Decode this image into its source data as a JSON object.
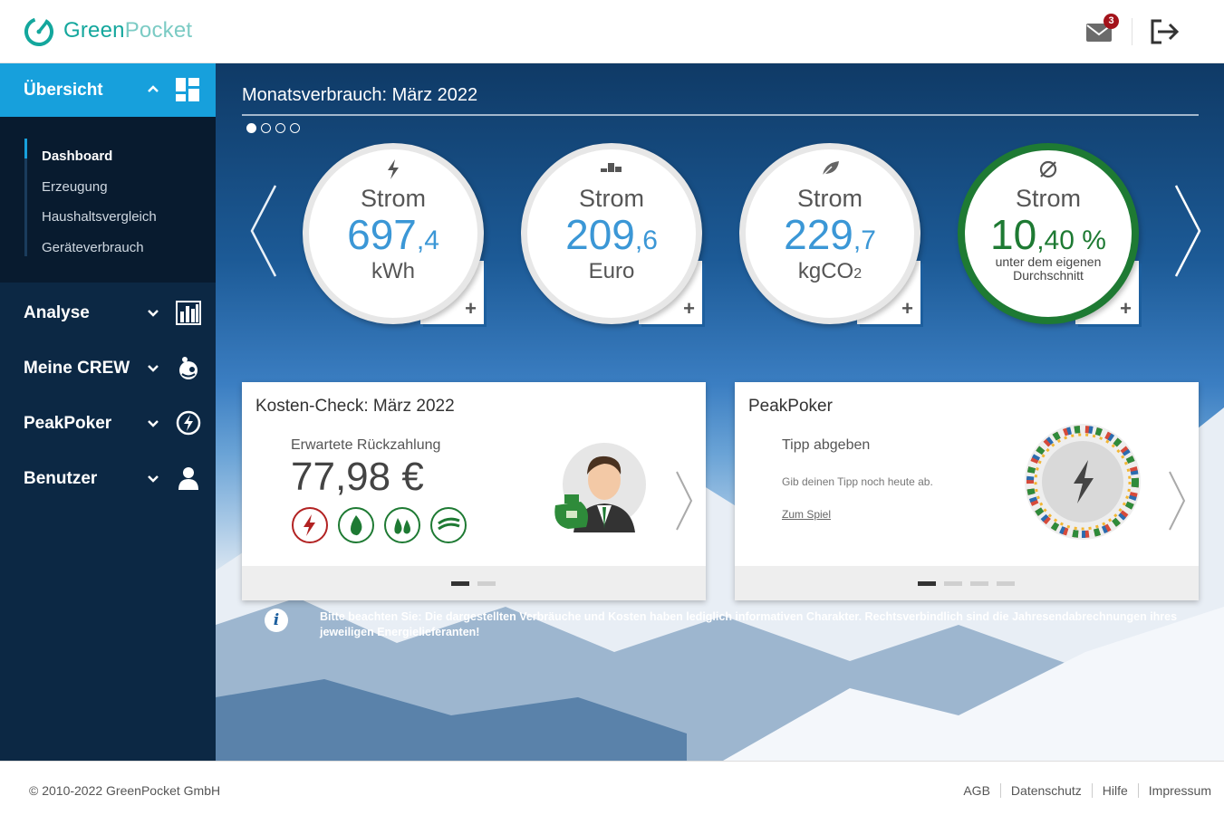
{
  "app": {
    "brand_part1": "Green",
    "brand_part2": "Pocket",
    "mail_badge": "3",
    "accent_color": "#17a0dc",
    "sidebar_color": "#0c2844",
    "brand_color": "#14a79d"
  },
  "sidebar": {
    "section": {
      "label": "Übersicht",
      "icon": "dashboard-grid-icon",
      "expanded": true
    },
    "subitems": [
      {
        "label": "Dashboard",
        "active": true
      },
      {
        "label": "Erzeugung"
      },
      {
        "label": "Haushaltsvergleich"
      },
      {
        "label": "Geräteverbrauch"
      }
    ],
    "items": [
      {
        "label": "Analyse",
        "icon": "bar-chart-icon"
      },
      {
        "label": "Meine CREW",
        "icon": "crew-icon"
      },
      {
        "label": "PeakPoker",
        "icon": "lightning-circle-icon"
      },
      {
        "label": "Benutzer",
        "icon": "user-icon"
      }
    ]
  },
  "main": {
    "title": "Monatsverbrauch: März 2022",
    "pager_count": 4,
    "pager_active": 0,
    "kpis": [
      {
        "icon": "lightning-icon",
        "label": "Strom",
        "value_int": "697",
        "value_dec": ",4",
        "unit": "kWh"
      },
      {
        "icon": "coins-icon",
        "label": "Strom",
        "value_int": "209",
        "value_dec": ",6",
        "unit": "Euro"
      },
      {
        "icon": "leaf-icon",
        "label": "Strom",
        "value_int": "229",
        "value_dec": ",7",
        "unit": "kgCO",
        "unit_sub": "2"
      },
      {
        "icon": "average-icon",
        "label": "Strom",
        "value_int": "10",
        "value_dec": ",40 %",
        "note": "unter dem eigenen Durchschnitt"
      }
    ],
    "kosten_card": {
      "title": "Kosten-Check: März 2022",
      "subtitle": "Erwartete Rückzahlung",
      "amount": "77,98 €",
      "energy_icons": [
        "strom-icon",
        "gas-icon",
        "wasser-icon",
        "fernwaerme-icon"
      ]
    },
    "peak_card": {
      "title": "PeakPoker",
      "subtitle": "Tipp abgeben",
      "text": "Gib deinen Tipp noch heute ab.",
      "link": "Zum Spiel"
    },
    "notice": "Bitte beachten Sie: Die dargestellten Verbräuche und Kosten haben lediglich informativen Charakter. Rechtsverbindlich sind die Jahresendabrechnungen ihres jeweiligen Energielieferanten!"
  },
  "footer": {
    "copyright": "© 2010-2022 GreenPocket GmbH",
    "links": [
      "AGB",
      "Datenschutz",
      "Hilfe",
      "Impressum"
    ]
  }
}
